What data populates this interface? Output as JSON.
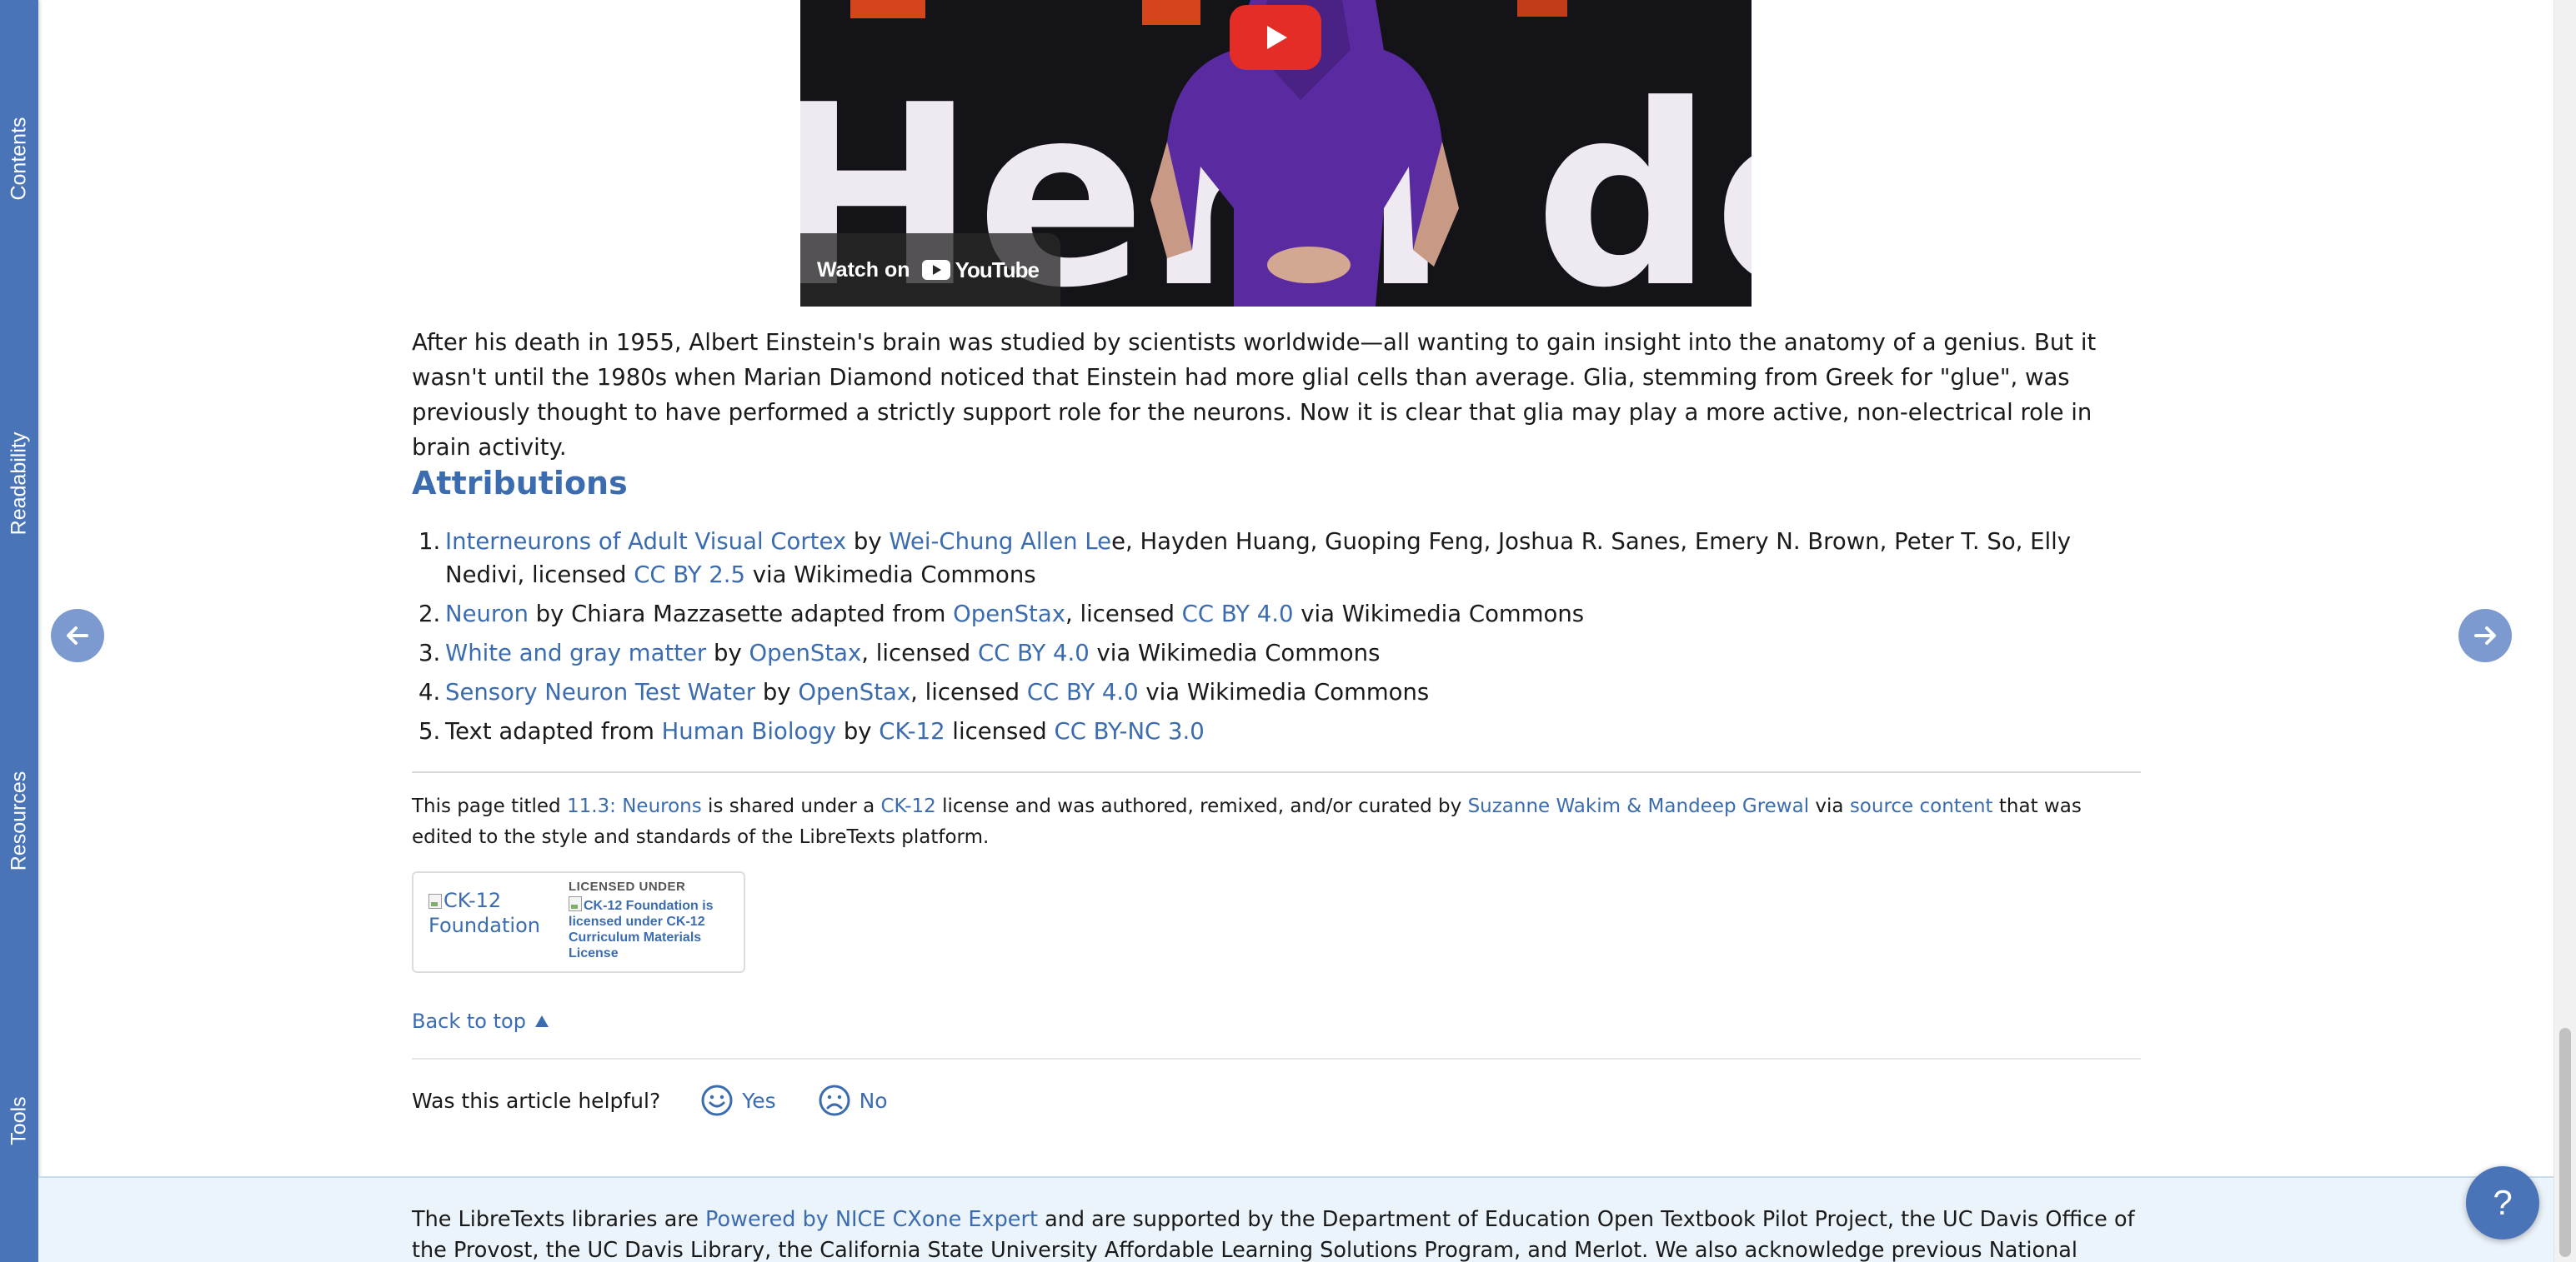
{
  "sidebar": {
    "tabs": [
      {
        "label": "Contents"
      },
      {
        "label": "Readability"
      },
      {
        "label": "Resources"
      },
      {
        "label": "Tools"
      }
    ]
  },
  "video": {
    "backdrop_text": "Hern don",
    "watch_on": "Watch on",
    "youtube_word": "YouTube"
  },
  "article": {
    "paragraph": "After his death in 1955, Albert Einstein's brain was studied by scientists worldwide—all wanting to gain insight into the anatomy of a genius. But it wasn't until the 1980s when Marian Diamond noticed that Einstein had more glial cells than average. Glia, stemming from Greek for \"glue\", was previously thought to have performed a strictly support role for the neurons. Now it is clear that glia may play a more active, non-electrical role in brain activity.",
    "attributions_heading": "Attributions",
    "attributions": [
      {
        "num": "1.",
        "title": "Interneurons of Adult Visual Cortex",
        "by": " by ",
        "author_link": "Wei-Chung Allen Le",
        "rest": "e, Hayden Huang, Guoping Feng, Joshua R. Sanes, Emery N. Brown, Peter T. So, Elly Nedivi, licensed ",
        "license": "CC BY 2.5",
        "tail": " via Wikimedia Commons"
      },
      {
        "num": "2.",
        "title": "Neuron",
        "mid": " by Chiara Mazzasette adapted from ",
        "source": "OpenStax",
        "lic_pre": ", licensed ",
        "license": "CC BY 4.0",
        "tail": " via Wikimedia Commons"
      },
      {
        "num": "3.",
        "title": "White and gray matter",
        "mid": " by ",
        "source": "OpenStax",
        "lic_pre": ", licensed ",
        "license": "CC BY 4.0",
        "tail": " via Wikimedia Commons"
      },
      {
        "num": "4.",
        "title": "Sensory Neuron Test Water",
        "mid": " by ",
        "source": "OpenStax",
        "lic_pre": ", licensed ",
        "license": "CC BY 4.0",
        "tail": " via Wikimedia Commons"
      },
      {
        "num": "5.",
        "pre": "Text adapted from ",
        "title": "Human Biology",
        "mid": " by ",
        "source": "CK-12",
        "lic_pre": " licensed ",
        "license": "CC BY-NC 3.0",
        "tail": ""
      }
    ]
  },
  "license_notice": {
    "t1": "This page titled ",
    "page_title": "11.3: Neurons",
    "t2": " is shared under a ",
    "license": "CK-12",
    "t3": " license and was authored, remixed, and/or curated by ",
    "authors": "Suzanne Wakim & Mandeep Grewal",
    "t4": " via ",
    "source": "source content",
    "t5": " that was edited to the style and standards of the LibreTexts platform."
  },
  "license_box": {
    "ck12_alt": "CK-12 Foundation",
    "licensed_under": "LICENSED UNDER",
    "license_alt": "CK-12 Foundation is licensed under CK-12 Curriculum Materials License"
  },
  "back_to_top": "Back to top",
  "feedback": {
    "question": "Was this article helpful?",
    "yes": "Yes",
    "no": "No"
  },
  "footer": {
    "t1": "The LibreTexts libraries are ",
    "powered": "Powered by NICE CXone Expert",
    "t2": " and are supported by the Department of Education Open Textbook Pilot Project, the UC Davis Office of the Provost, the UC Davis Library, the California State University Affordable Learning Solutions Program, and Merlot. We also acknowledge previous National Science Foundation support under grant"
  },
  "help_button": "?",
  "colors": {
    "sidebar": "#4a74b8",
    "link": "#3b6cb0",
    "nav_arrow": "#7c99d0",
    "youtube_red": "#e52d27",
    "footer_bg": "#ebf3fb"
  }
}
